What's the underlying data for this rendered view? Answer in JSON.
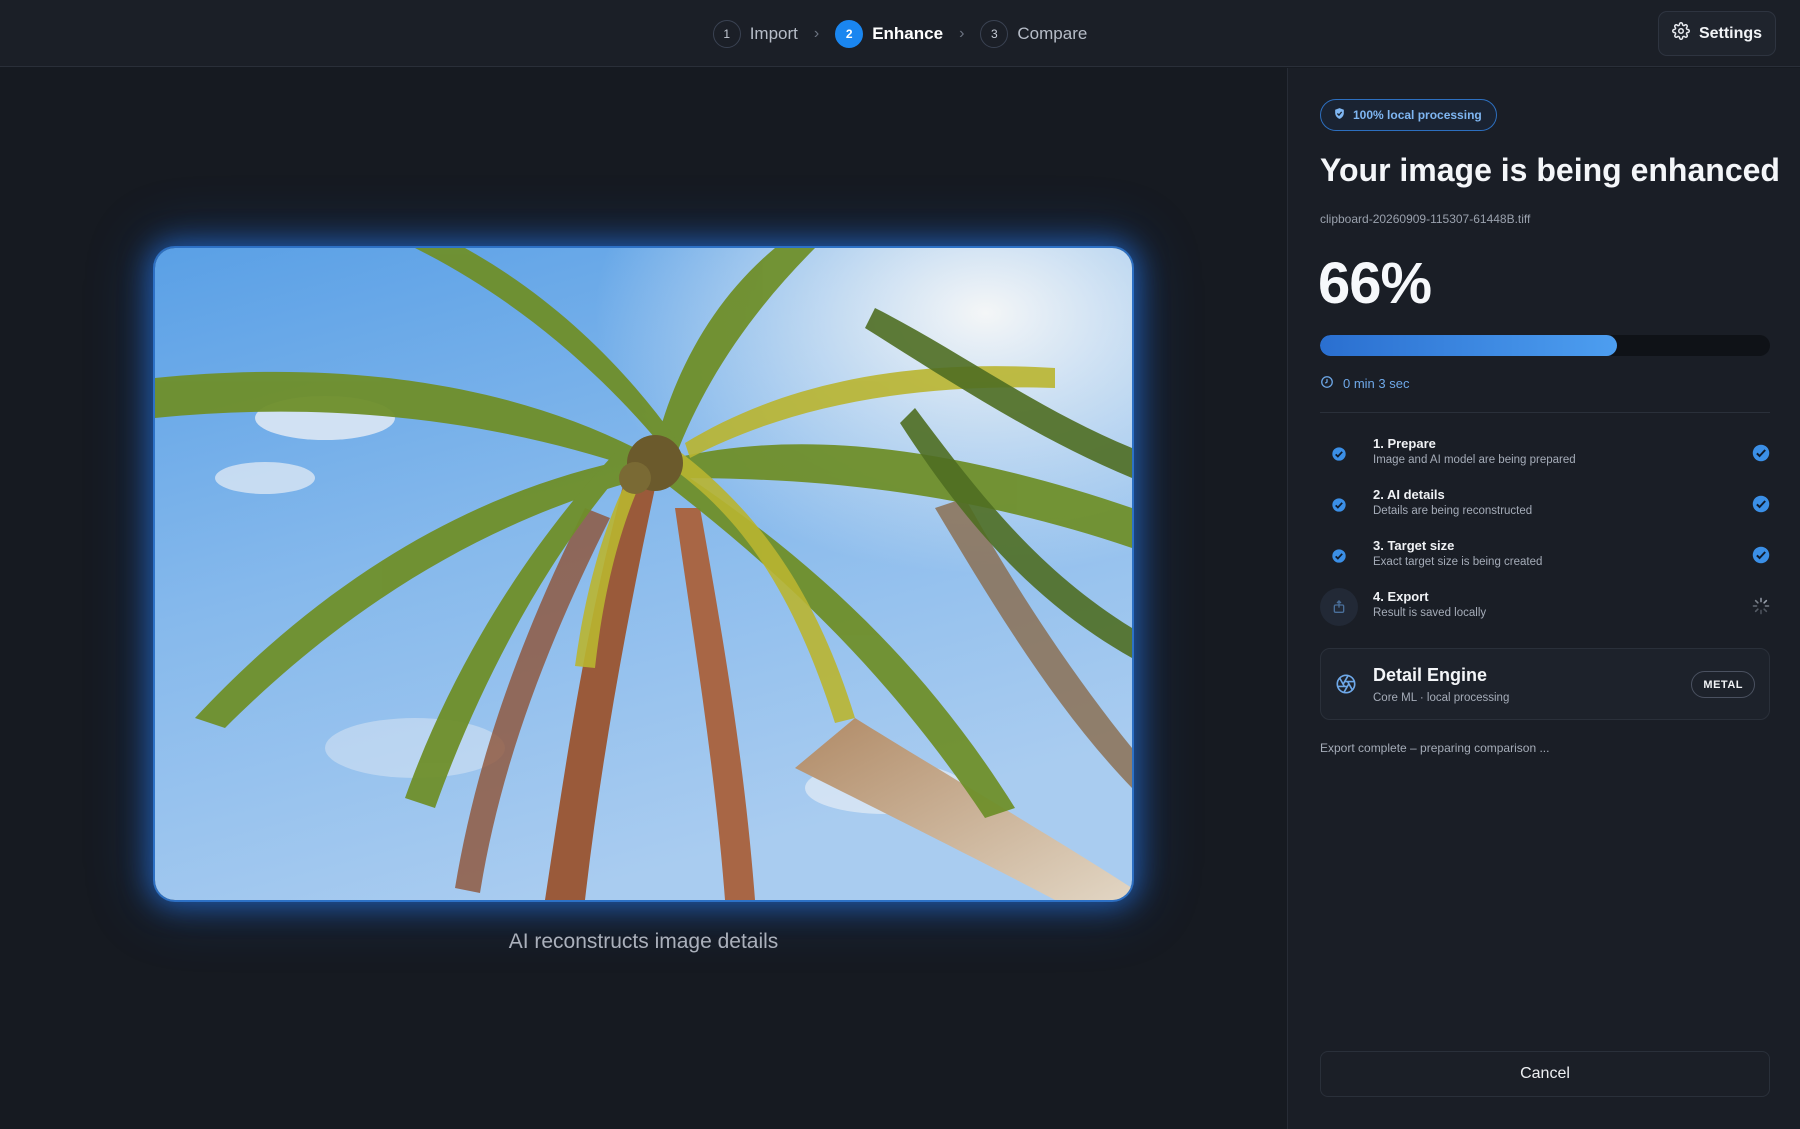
{
  "stepper": {
    "steps": [
      {
        "num": "1",
        "label": "Import"
      },
      {
        "num": "2",
        "label": "Enhance"
      },
      {
        "num": "3",
        "label": "Compare"
      }
    ],
    "active_step": 2
  },
  "header": {
    "settings_label": "Settings"
  },
  "preview": {
    "caption": "AI reconstructs image details"
  },
  "panel": {
    "badge": "100% local processing",
    "title": "Your image is being enhanced",
    "filename": "clipboard-20260909-115307-61448B.tiff",
    "percent": "66%",
    "progress": 0.66,
    "eta": "0 min 3 sec",
    "steps": [
      {
        "title": "1. Prepare",
        "subtitle": "Image and AI model are being prepared",
        "state": "done"
      },
      {
        "title": "2. AI details",
        "subtitle": "Details are being reconstructed",
        "state": "done"
      },
      {
        "title": "3. Target size",
        "subtitle": "Exact target size is being created",
        "state": "done"
      },
      {
        "title": "4. Export",
        "subtitle": "Result is saved locally",
        "state": "in-progress"
      }
    ],
    "engine": {
      "title": "Detail Engine",
      "subtitle": "Core ML · local processing",
      "badge": "METAL"
    },
    "status": "Export complete – preparing comparison ...",
    "cancel_label": "Cancel"
  },
  "colors": {
    "accent": "#1a86f0",
    "background": "#161a21",
    "panel": "#1a1e26",
    "glow": "#2a82ff"
  }
}
